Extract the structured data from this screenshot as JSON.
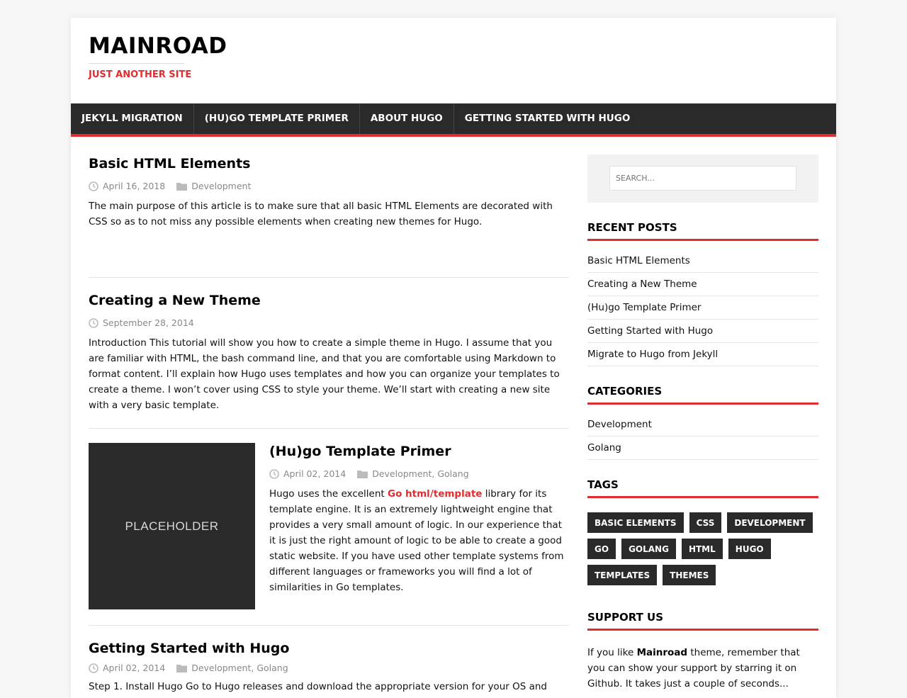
{
  "site": {
    "title": "MAINROAD",
    "subtitle": "JUST ANOTHER SITE"
  },
  "menu": {
    "items": [
      {
        "label": "JEKYLL MIGRATION"
      },
      {
        "label": "(HU)GO TEMPLATE PRIMER"
      },
      {
        "label": "ABOUT HUGO"
      },
      {
        "label": "GETTING STARTED WITH HUGO"
      }
    ]
  },
  "posts": [
    {
      "title": "Basic HTML Elements",
      "date": "April 16, 2018",
      "categories": "Development",
      "excerpt": "The main purpose of this article is to make sure that all basic HTML Elements are decorated with CSS so as to not miss any possible elements when creating new themes for Hugo."
    },
    {
      "title": "Creating a New Theme",
      "date": "September 28, 2014",
      "excerpt": "Introduction This tutorial will show you how to create a simple theme in Hugo. I assume that you are familiar with HTML, the bash command line, and that you are comfortable using Markdown to format content. I’ll explain how Hugo uses templates and how you can organize your templates to create a theme. I won’t cover using CSS to style your theme. We’ll start with creating a new site with a very basic template."
    },
    {
      "title": "(Hu)go Template Primer",
      "date": "April 02, 2014",
      "categories": "Development, Golang",
      "thumbnail_label": "PLACEHOLDER",
      "excerpt_before": "Hugo uses the excellent ",
      "excerpt_link": "Go html/template",
      "excerpt_after": " library for its template engine. It is an extremely lightweight engine that provides a very small amount of logic. In our experience that it is just the right amount of logic to be able to create a good static website. If you have used other template systems from different languages or frameworks you will find a lot of similarities in Go templates."
    },
    {
      "title": "Getting Started with Hugo",
      "date": "April 02, 2014",
      "categories": "Development, Golang",
      "excerpt": "Step 1. Install Hugo Go to Hugo releases and download the appropriate version for your OS and"
    }
  ],
  "sidebar": {
    "search_placeholder": "SEARCH...",
    "recent_posts": {
      "title": "RECENT POSTS",
      "items": [
        {
          "label": "Basic HTML Elements"
        },
        {
          "label": "Creating a New Theme"
        },
        {
          "label": "(Hu)go Template Primer"
        },
        {
          "label": "Getting Started with Hugo"
        },
        {
          "label": "Migrate to Hugo from Jekyll"
        }
      ]
    },
    "categories": {
      "title": "CATEGORIES",
      "items": [
        {
          "label": "Development"
        },
        {
          "label": "Golang"
        }
      ]
    },
    "tags": {
      "title": "TAGS",
      "items": [
        {
          "label": "BASIC ELEMENTS"
        },
        {
          "label": "CSS"
        },
        {
          "label": "DEVELOPMENT"
        },
        {
          "label": "GO"
        },
        {
          "label": "GOLANG"
        },
        {
          "label": "HTML"
        },
        {
          "label": "HUGO"
        },
        {
          "label": "TEMPLATES"
        },
        {
          "label": "THEMES"
        }
      ]
    },
    "support": {
      "title": "SUPPORT US",
      "text_before": "If you like ",
      "text_bold": "Mainroad",
      "text_after": " theme, remember that you can show your support by starring it on Github. It takes just a couple of seconds..."
    }
  },
  "colors": {
    "accent": "#e22d30",
    "dark": "#2a2a2a",
    "background": "#f7f7f7"
  },
  "icons": {
    "date": "clock-icon",
    "category": "folder-icon"
  }
}
